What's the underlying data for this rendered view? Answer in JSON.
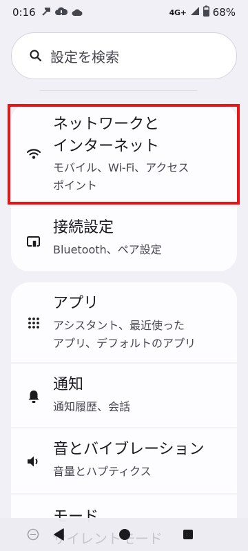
{
  "status_bar": {
    "time": "0:16",
    "network": "4G+",
    "battery": "68%",
    "icons_left": [
      "hammer-icon",
      "cloud-alert-icon",
      "cloud-icon"
    ],
    "icons_right": [
      "signal-icon",
      "battery-icon"
    ]
  },
  "search": {
    "placeholder": "設定を検索",
    "icon": "search-icon"
  },
  "settings": {
    "network": {
      "title_line1": "ネットワークと",
      "title_line2": "インターネット",
      "sub_line1": "モバイル、Wi-Fi、アクセス",
      "sub_line2": "ポイント",
      "icon": "wifi-icon"
    },
    "connections": {
      "title": "接続設定",
      "sub": "Bluetooth、ペア設定",
      "icon": "connected-devices-icon"
    },
    "apps": {
      "title": "アプリ",
      "sub_line1": "アシスタント、最近使った",
      "sub_line2": "アプリ、デフォルトのアプリ",
      "icon": "apps-grid-icon"
    },
    "notifications": {
      "title": "通知",
      "sub": "通知履歴、会話",
      "icon": "bell-icon"
    },
    "sound": {
      "title": "音とバイブレーション",
      "sub": "音量とハプティクス",
      "icon": "speaker-icon"
    },
    "modes": {
      "title": "モード",
      "sub": "サイレントモード"
    }
  },
  "nav_bar": {
    "back": "back-icon",
    "home": "home-icon",
    "recents": "recents-icon"
  },
  "colors": {
    "background": "#f1f0f6",
    "card": "#fdfcff",
    "highlight": "#e81416"
  }
}
